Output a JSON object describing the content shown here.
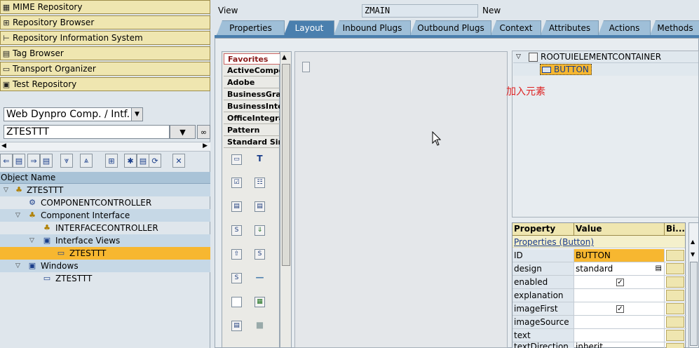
{
  "nav": [
    {
      "label": "MIME Repository",
      "icon": "mime-icon"
    },
    {
      "label": "Repository Browser",
      "icon": "hierarchy-icon"
    },
    {
      "label": "Repository Information System",
      "icon": "tree-icon"
    },
    {
      "label": "Tag Browser",
      "icon": "tag-icon"
    },
    {
      "label": "Transport Organizer",
      "icon": "truck-icon"
    },
    {
      "label": "Test Repository",
      "icon": "test-icon"
    }
  ],
  "object_type": {
    "selected": "Web Dynpro Comp. / Intf."
  },
  "object_name": {
    "value": "ZTESTTT"
  },
  "tree": {
    "header": "Object Name",
    "rows": [
      {
        "label": "ZTESTTT"
      },
      {
        "label": "COMPONENTCONTROLLER"
      },
      {
        "label": "Component Interface"
      },
      {
        "label": "INTERFACECONTROLLER"
      },
      {
        "label": "Interface Views"
      },
      {
        "label": "ZTESTTT"
      },
      {
        "label": "Windows"
      },
      {
        "label": "ZTESTTT"
      }
    ]
  },
  "view": {
    "label": "View",
    "name": "ZMAIN",
    "status": "New"
  },
  "tabs": [
    {
      "label": "Properties"
    },
    {
      "label": "Layout"
    },
    {
      "label": "Inbound Plugs"
    },
    {
      "label": "Outbound Plugs"
    },
    {
      "label": "Context"
    },
    {
      "label": "Attributes"
    },
    {
      "label": "Actions"
    },
    {
      "label": "Methods"
    }
  ],
  "palette": {
    "sections": [
      "Favorites",
      "ActiveComponent",
      "Adobe",
      "BusinessGraphics",
      "BusinessIntelligence",
      "OfficeIntegration",
      "Pattern",
      "Standard Simple"
    ]
  },
  "element_tree": {
    "root": "ROOTUIELEMENTCONTAINER",
    "child": "BUTTON"
  },
  "annotation": "加入元素",
  "properties": {
    "headers": [
      "Property",
      "Value",
      "Bi..."
    ],
    "title": "Properties (Button)",
    "rows": [
      {
        "name": "ID",
        "value": "BUTTON"
      },
      {
        "name": "design",
        "value": "standard"
      },
      {
        "name": "enabled",
        "value": "",
        "checked": true
      },
      {
        "name": "explanation",
        "value": ""
      },
      {
        "name": "imageFirst",
        "value": "",
        "checked": true
      },
      {
        "name": "imageSource",
        "value": ""
      },
      {
        "name": "text",
        "value": ""
      },
      {
        "name": "textDirection",
        "value": "inherit"
      }
    ]
  },
  "colors": {
    "nav_bg": "#efe6b0",
    "tab_active": "#4a7fae",
    "tab_inactive": "#9fbfd8",
    "selection": "#f7b730",
    "annotation": "#dd2222"
  }
}
